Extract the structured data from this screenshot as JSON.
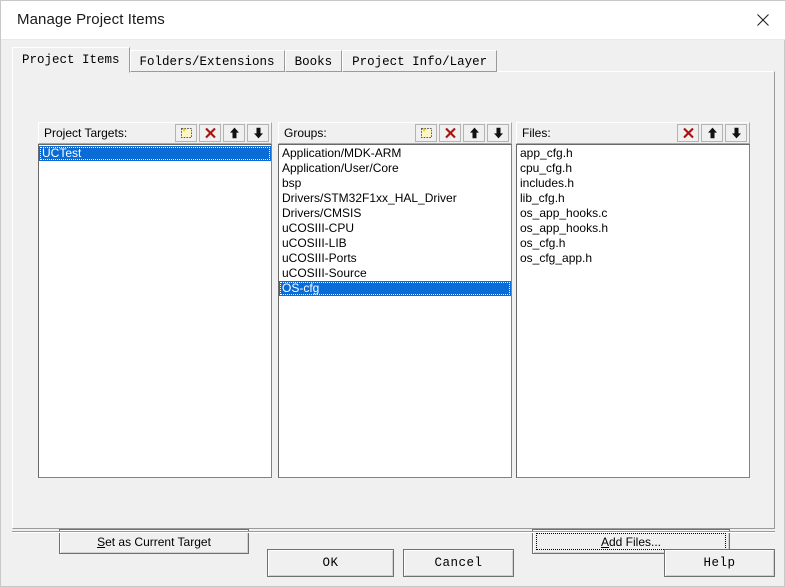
{
  "window": {
    "title": "Manage Project Items",
    "close_icon": "close-icon"
  },
  "tabs": [
    {
      "label": "Project Items",
      "active": true
    },
    {
      "label": "Folders/Extensions",
      "active": false
    },
    {
      "label": "Books",
      "active": false
    },
    {
      "label": "Project Info/Layer",
      "active": false
    }
  ],
  "columns": {
    "targets": {
      "header": "Project Targets:",
      "icons": [
        "new-item-icon",
        "delete-icon",
        "move-up-icon",
        "move-down-icon"
      ],
      "items": [
        "UCTest"
      ],
      "selected_index": 0
    },
    "groups": {
      "header": "Groups:",
      "icons": [
        "new-item-icon",
        "delete-icon",
        "move-up-icon",
        "move-down-icon"
      ],
      "items": [
        "Application/MDK-ARM",
        "Application/User/Core",
        "bsp",
        "Drivers/STM32F1xx_HAL_Driver",
        "Drivers/CMSIS",
        "uCOSIII-CPU",
        "uCOSIII-LIB",
        "uCOSIII-Ports",
        "uCOSIII-Source",
        "OS-cfg"
      ],
      "selected_index": 9
    },
    "files": {
      "header": "Files:",
      "icons": [
        "delete-icon",
        "move-up-icon",
        "move-down-icon"
      ],
      "items": [
        "app_cfg.h",
        "cpu_cfg.h",
        "includes.h",
        "lib_cfg.h",
        "os_app_hooks.c",
        "os_app_hooks.h",
        "os_cfg.h",
        "os_cfg_app.h"
      ],
      "selected_index": -1
    }
  },
  "buttons": {
    "set_current_target": {
      "prefix": "",
      "accel": "S",
      "suffix": "et as Current Target"
    },
    "add_files": {
      "prefix": "",
      "accel": "A",
      "suffix": "dd Files...",
      "focused": true
    },
    "ok": "OK",
    "cancel": "Cancel",
    "help": "Help"
  },
  "colors": {
    "selection_blue": "#0a6cd6",
    "delete_red": "#aa1111",
    "dialog_face": "#f0f0f0",
    "list_white": "#ffffff"
  }
}
